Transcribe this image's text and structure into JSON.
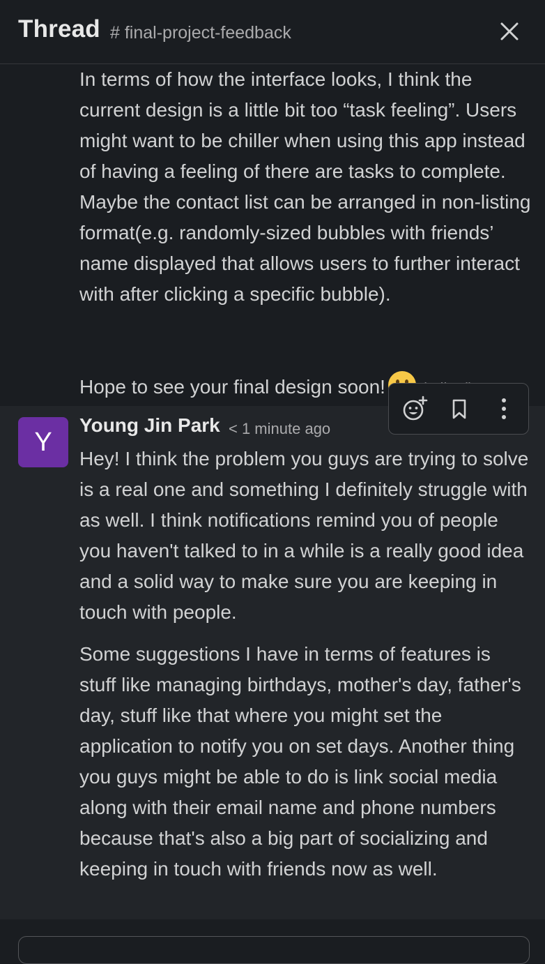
{
  "header": {
    "title": "Thread",
    "channel": "# final-project-feedback"
  },
  "previous_message": {
    "paragraph_1": "In terms of how the interface looks, I think the current design is a little bit too “task feeling”. Users might want to be chiller when using this app instead of having a feeling of there are tasks to complete. Maybe the contact list can be arranged in non-listing format(e.g. randomly-sized bubbles with friends’ name displayed that allows users to further interact with after clicking a specific bubble).",
    "paragraph_2": "Hope to see your final design soon!",
    "edited_label": "(edited)",
    "emoji_icon": "smile-emoji-icon"
  },
  "current_message": {
    "avatar_letter": "Y",
    "avatar_color": "#6b2fa3",
    "author": "Young Jin Park",
    "timestamp": "< 1 minute ago",
    "paragraph_1": "Hey! I think the problem you guys are trying to solve is a real one and something I definitely struggle with as well. I think notifications remind you of people you haven't talked to in a while is a really good idea and a solid way to make sure you are keeping in touch with people.",
    "paragraph_2": "Some suggestions I have in terms of features is stuff like managing birthdays, mother's day, father's day, stuff like that where you might set the application to notify you on set days. Another thing you guys might be able to do is link social media along with their email name and phone numbers because that's also a big part of socializing and keeping in touch with friends now as well."
  },
  "message_toolbar": {
    "icons": [
      "add-reaction-icon",
      "bookmark-icon",
      "more-vertical-icon"
    ]
  },
  "colors": {
    "background": "#1a1d21",
    "hover_background": "#222529",
    "text": "#d1d2d3"
  }
}
